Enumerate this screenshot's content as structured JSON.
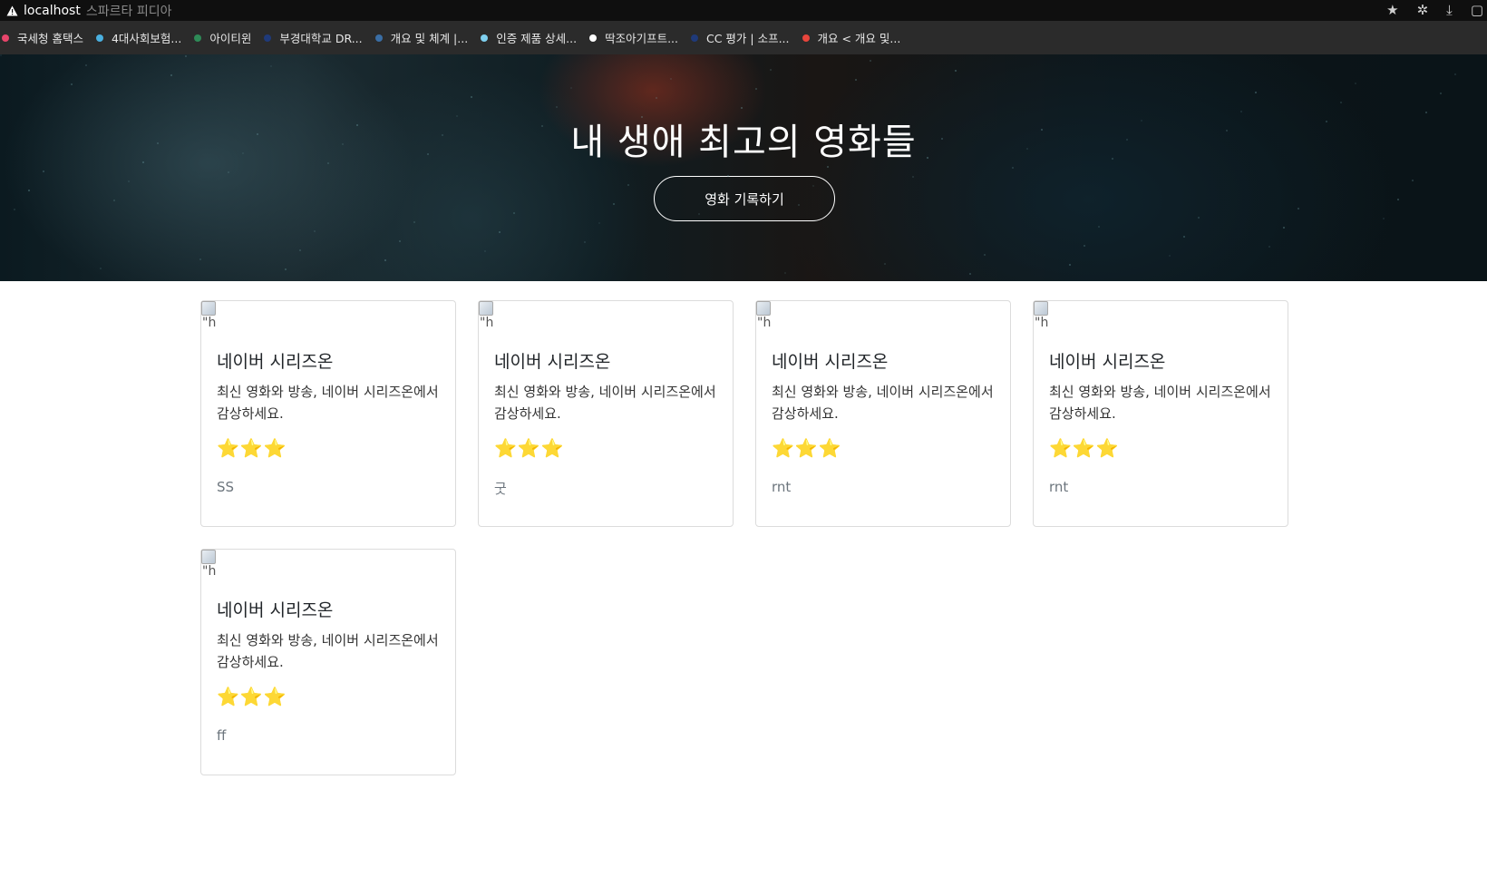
{
  "browser": {
    "host": "localhost",
    "page_title": "스파르타 피디아",
    "bookmarks": [
      {
        "label": "국세청 홈택스",
        "color": "#e8456b"
      },
      {
        "label": "4대사회보험...",
        "color": "#4ab0e0"
      },
      {
        "label": "아이티윈",
        "color": "#2e8b57"
      },
      {
        "label": "부경대학교 DR...",
        "color": "#1f3a7a"
      },
      {
        "label": "개요 및 체계 |...",
        "color": "#3a6ea5"
      },
      {
        "label": "인증 제품 상세...",
        "color": "#7fd0ef"
      },
      {
        "label": "딱조아기프트...",
        "color": "#ffffff"
      },
      {
        "label": "CC 평가 | 소프...",
        "color": "#1f3a7a"
      },
      {
        "label": "개요 < 개요 및...",
        "color": "#e8453c"
      }
    ],
    "icons": [
      "warning-icon",
      "star-icon",
      "extensions-icon",
      "download-icon",
      "window-icon"
    ]
  },
  "hero": {
    "title": "내 생애 최고의 영화들",
    "button_label": "영화 기록하기"
  },
  "cards": [
    {
      "img_alt": "\"h",
      "title": "네이버 시리즈온",
      "desc": "최신 영화와 방송, 네이버 시리즈온에서 감상하세요.",
      "stars": "⭐⭐⭐",
      "star_count": 3,
      "comment": "SS"
    },
    {
      "img_alt": "\"h",
      "title": "네이버 시리즈온",
      "desc": "최신 영화와 방송, 네이버 시리즈온에서 감상하세요.",
      "stars": "⭐⭐⭐",
      "star_count": 3,
      "comment": "굿"
    },
    {
      "img_alt": "\"h",
      "title": "네이버 시리즈온",
      "desc": "최신 영화와 방송, 네이버 시리즈온에서 감상하세요.",
      "stars": "⭐⭐⭐",
      "star_count": 3,
      "comment": "rnt"
    },
    {
      "img_alt": "\"h",
      "title": "네이버 시리즈온",
      "desc": "최신 영화와 방송, 네이버 시리즈온에서 감상하세요.",
      "stars": "⭐⭐⭐",
      "star_count": 3,
      "comment": "rnt"
    },
    {
      "img_alt": "\"h",
      "title": "네이버 시리즈온",
      "desc": "최신 영화와 방송, 네이버 시리즈온에서 감상하세요.",
      "stars": "⭐⭐⭐",
      "star_count": 3,
      "comment": "ff"
    }
  ]
}
